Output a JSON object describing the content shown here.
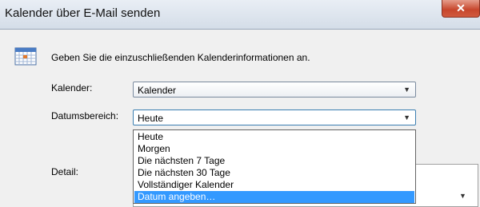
{
  "window": {
    "title": "Kalender über E-Mail senden",
    "close_glyph": "✕"
  },
  "instruction": "Geben Sie die einzuschließenden Kalenderinformationen an.",
  "calendar": {
    "label": "Kalender:",
    "value": "Kalender"
  },
  "date_range": {
    "label": "Datumsbereich:",
    "value": "Heute",
    "options": [
      "Heute",
      "Morgen",
      "Die nächsten 7 Tage",
      "Die nächsten 30 Tage",
      "Vollständiger Kalender",
      "Datum angeben…"
    ],
    "highlighted_index": 5
  },
  "detail": {
    "label": "Detail:"
  },
  "colors": {
    "highlight": "#3399ff",
    "close_button": "#c7462c"
  },
  "icons": {
    "calendar": "calendar-icon",
    "dropdown_arrow": "▼"
  }
}
